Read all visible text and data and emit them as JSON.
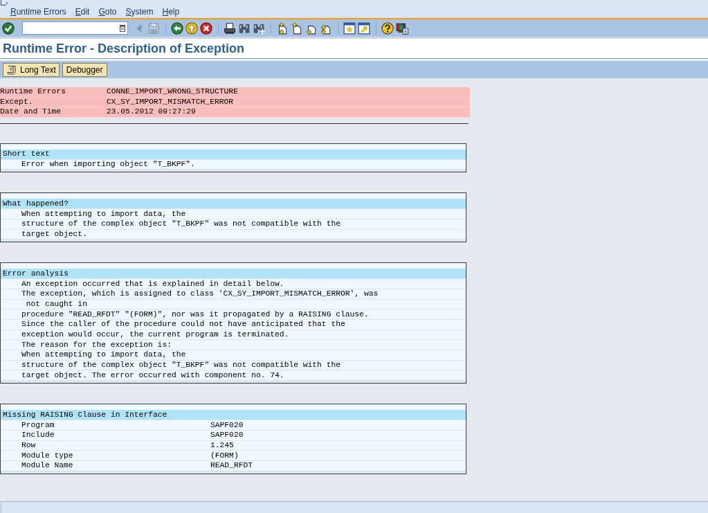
{
  "menu_bar": {
    "items": [
      {
        "label": "Runtime Errors"
      },
      {
        "label": "Edit"
      },
      {
        "label": "Goto"
      },
      {
        "label": "System"
      },
      {
        "label": "Help"
      }
    ]
  },
  "toolbar": {
    "items": [
      {
        "kind": "enter",
        "disabled": false
      },
      {
        "kind": "command_field"
      },
      {
        "kind": "collapse",
        "disabled": true
      },
      {
        "kind": "save",
        "disabled": true
      },
      {
        "kind": "separator"
      },
      {
        "kind": "back",
        "disabled": false
      },
      {
        "kind": "exit",
        "disabled": false
      },
      {
        "kind": "cancel",
        "disabled": false
      },
      {
        "kind": "separator"
      },
      {
        "kind": "print",
        "disabled": false
      },
      {
        "kind": "find",
        "disabled": false
      },
      {
        "kind": "find_next",
        "disabled": false
      },
      {
        "kind": "separator"
      },
      {
        "kind": "first_page",
        "disabled": false
      },
      {
        "kind": "previous_page",
        "disabled": false
      },
      {
        "kind": "next_page",
        "disabled": false
      },
      {
        "kind": "last_page",
        "disabled": false
      },
      {
        "kind": "separator"
      },
      {
        "kind": "new_session",
        "disabled": false
      },
      {
        "kind": "shortcut",
        "disabled": false
      },
      {
        "kind": "separator"
      },
      {
        "kind": "help",
        "disabled": false
      },
      {
        "kind": "layout",
        "disabled": false
      }
    ]
  },
  "title": "Runtime Error - Description of Exception",
  "app_toolbar": {
    "buttons": [
      {
        "kind": "icon_text",
        "label": "Long Text"
      },
      {
        "kind": "text",
        "label": "Debugger"
      }
    ]
  },
  "header_fields": [
    {
      "label": "Runtime Errors",
      "value": "CONNE_IMPORT_WRONG_STRUCTURE"
    },
    {
      "label": "Except.",
      "value": "CX_SY_IMPORT_MISMATCH_ERROR"
    },
    {
      "label": "Date and Time",
      "value": "23.05.2012 09:27:29"
    }
  ],
  "sections": [
    {
      "kind": "text",
      "title": "Short text",
      "lines": [
        "Error when importing object \"T_BKPF\"."
      ]
    },
    {
      "kind": "text",
      "title": "What happened?",
      "lines": [
        "When attempting to import data, the",
        "structure of the complex object \"T_BKPF\" was not compatible with the",
        "target object."
      ]
    },
    {
      "kind": "text",
      "title": "Error analysis",
      "lines": [
        "An exception occurred that is explained in detail below.",
        "The exception, which is assigned to class 'CX_SY_IMPORT_MISMATCH_ERROR', was",
        " not caught in",
        "procedure \"READ_RFDT\" \"(FORM)\", nor was it propagated by a RAISING clause.",
        "Since the caller of the procedure could not have anticipated that the",
        "exception would occur, the current program is terminated.",
        "The reason for the exception is:",
        "When attempting to import data, the",
        "structure of the complex object \"T_BKPF\" was not compatible with the",
        "target object. The error occurred with component no. 74."
      ]
    },
    {
      "kind": "fields",
      "title": "Missing RAISING Clause in Interface",
      "rows": [
        {
          "label": "Program",
          "value": "SAPF020"
        },
        {
          "label": "Include",
          "value": "SAPF020"
        },
        {
          "label": "Row",
          "value": "1.245"
        },
        {
          "label": "Module type",
          "value": "(FORM)"
        },
        {
          "label": "Module Name",
          "value": "READ_RFDT"
        }
      ]
    }
  ]
}
